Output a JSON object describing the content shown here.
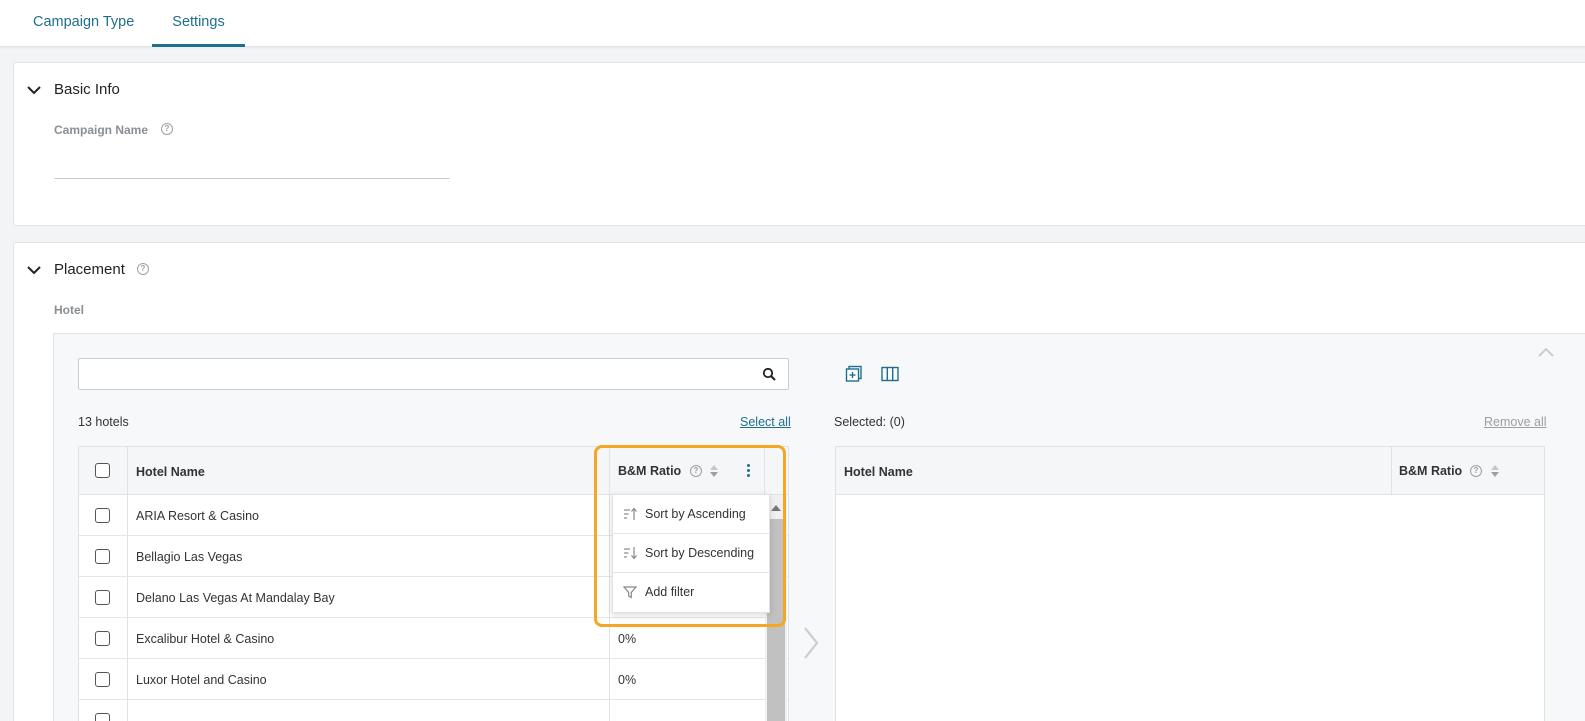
{
  "tabs": [
    {
      "label": "Campaign Type",
      "active": false
    },
    {
      "label": "Settings",
      "active": true
    }
  ],
  "basic_info": {
    "title": "Basic Info",
    "campaign_name_label": "Campaign Name",
    "help": "?",
    "campaign_name_value": ""
  },
  "placement": {
    "title": "Placement",
    "help": "?",
    "hotel_label": "Hotel"
  },
  "left_table": {
    "search_value": "",
    "count_text": "13 hotels",
    "select_all": "Select all",
    "col_hotel_name": "Hotel Name",
    "col_ratio": "B&M Ratio",
    "rows": [
      {
        "name": "ARIA Resort & Casino",
        "ratio": ""
      },
      {
        "name": "Bellagio Las Vegas",
        "ratio": ""
      },
      {
        "name": "Delano Las Vegas At Mandalay Bay",
        "ratio": ""
      },
      {
        "name": "Excalibur Hotel & Casino",
        "ratio": "0%"
      },
      {
        "name": "Luxor Hotel and Casino",
        "ratio": "0%"
      }
    ]
  },
  "dropdown_menu": [
    {
      "label": "Sort by Ascending",
      "icon": "sort-ascending-icon"
    },
    {
      "label": "Sort by Descending",
      "icon": "sort-descending-icon"
    },
    {
      "label": "Add filter",
      "icon": "filter-icon"
    }
  ],
  "right_table": {
    "selected_text": "Selected: (0)",
    "remove_all": "Remove all",
    "col_hotel_name": "Hotel Name",
    "col_ratio": "B&M Ratio"
  },
  "colors": {
    "accent": "#1f6f8b",
    "highlight": "#f5a623"
  }
}
